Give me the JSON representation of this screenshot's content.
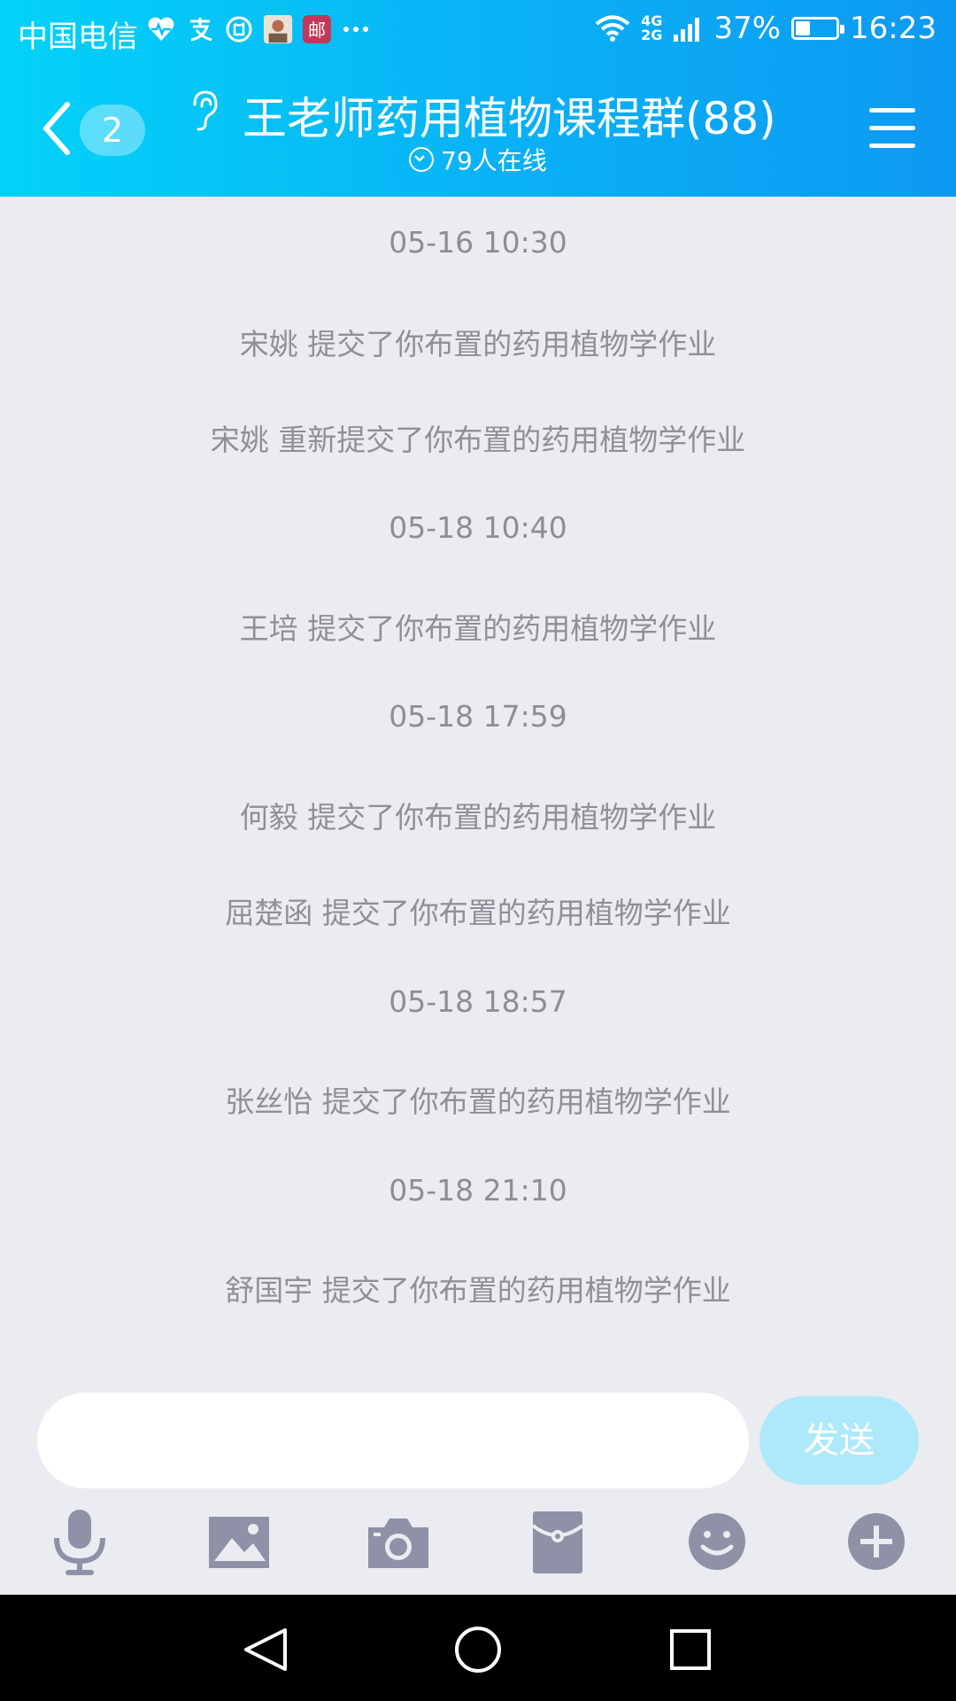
{
  "status_bar": {
    "carrier": "中国电信",
    "notification_icons": [
      "heart-monitor-icon",
      "alipay-icon",
      "shield-app-icon",
      "avatar-app-icon",
      "postal-icon",
      "more-dots-icon"
    ],
    "network": [
      "4G",
      "2G"
    ],
    "battery": "37%",
    "battery_level": 0.37,
    "time": "16:23"
  },
  "header": {
    "unread_count": "2",
    "title": "王老师药用植物课程群(88)",
    "online": "79人在线"
  },
  "messages": [
    {
      "type": "time",
      "text": "05-16 10:30"
    },
    {
      "type": "system",
      "text": "宋姚 提交了你布置的药用植物学作业"
    },
    {
      "type": "system",
      "text": "宋姚 重新提交了你布置的药用植物学作业"
    },
    {
      "type": "time",
      "text": "05-18 10:40"
    },
    {
      "type": "system",
      "text": "王培 提交了你布置的药用植物学作业"
    },
    {
      "type": "time",
      "text": "05-18 17:59"
    },
    {
      "type": "system",
      "text": "何毅 提交了你布置的药用植物学作业"
    },
    {
      "type": "system",
      "text": "屈楚函 提交了你布置的药用植物学作业"
    },
    {
      "type": "time",
      "text": "05-18 18:57"
    },
    {
      "type": "system",
      "text": "张丝怡 提交了你布置的药用植物学作业"
    },
    {
      "type": "time",
      "text": "05-18 21:10"
    },
    {
      "type": "system",
      "text": "舒国宇 提交了你布置的药用植物学作业"
    }
  ],
  "input": {
    "placeholder": "",
    "value": "",
    "send_label": "发送"
  },
  "toolbar": [
    "microphone-icon",
    "image-icon",
    "camera-icon",
    "red-packet-icon",
    "emoji-icon",
    "plus-icon"
  ],
  "colors": {
    "header_start": "#03d2f8",
    "header_end": "#0d99f2",
    "chat_bg": "#ebecf2",
    "system_text": "#8f9097",
    "send_button": "#ade9fb",
    "toolbar_icon": "#8f91a6"
  }
}
